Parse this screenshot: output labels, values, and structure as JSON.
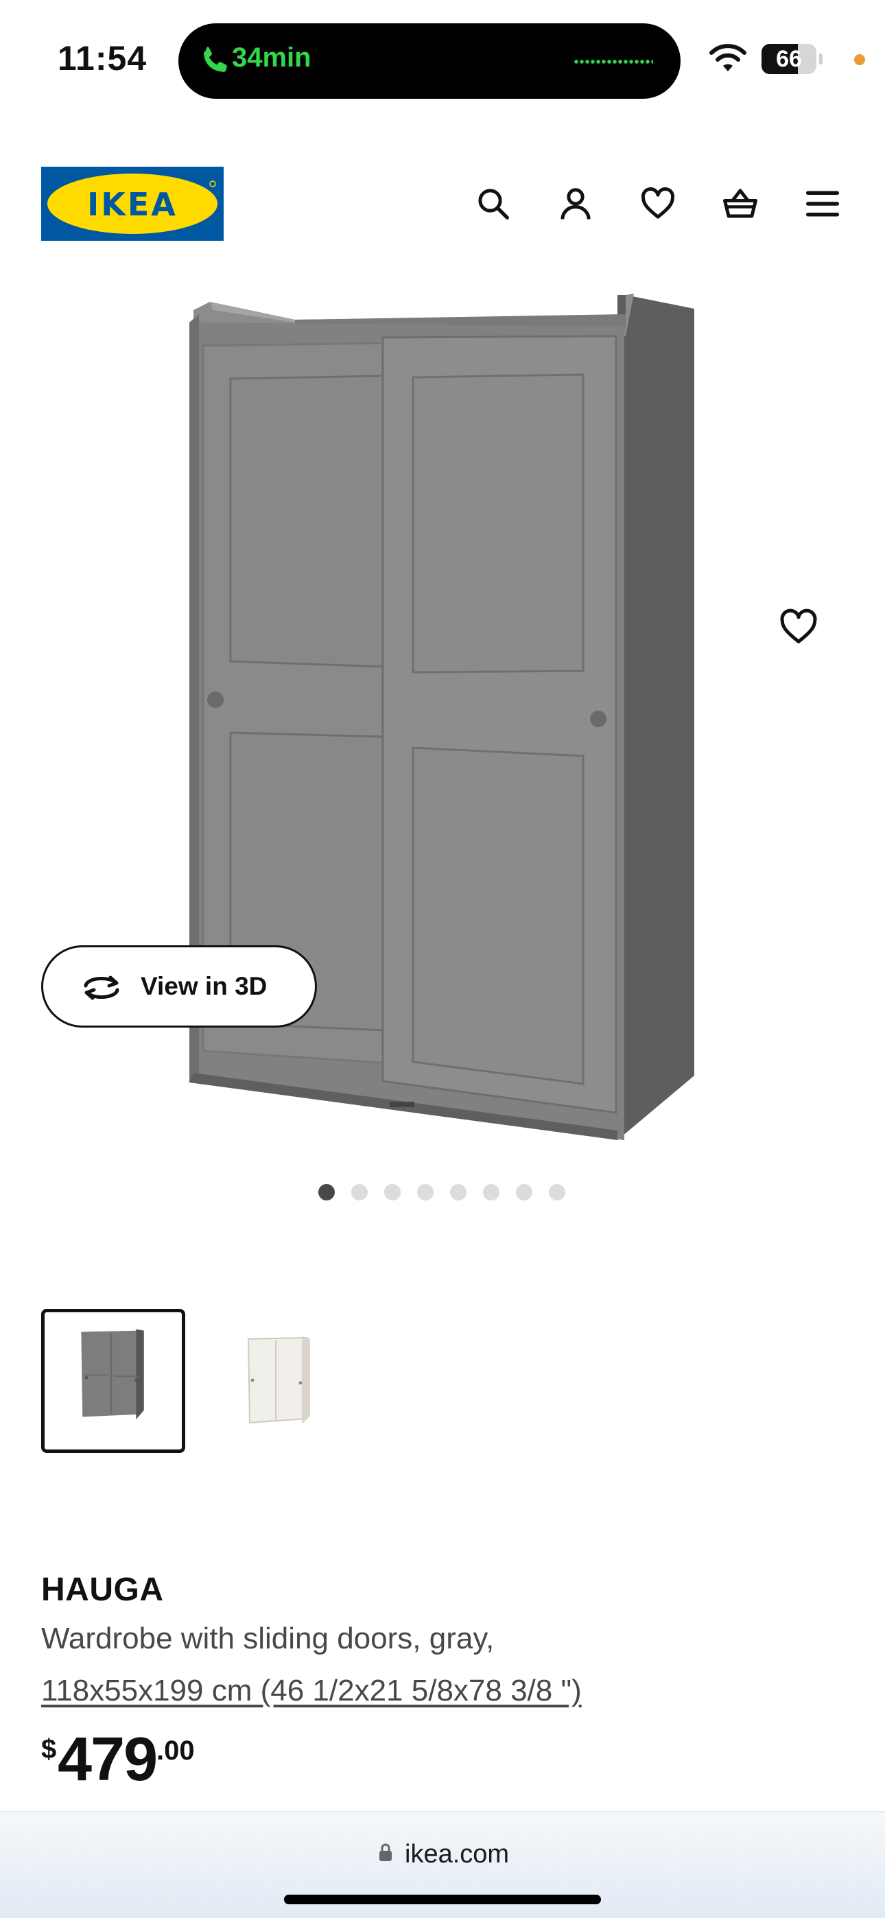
{
  "status_bar": {
    "time": "11:54",
    "call_timer": "34min",
    "battery_level": "66",
    "battery_fraction": 0.66,
    "icons": [
      "phone-icon",
      "wifi-icon",
      "battery-icon"
    ]
  },
  "header": {
    "logo_text": "IKEA",
    "logo_colors": {
      "blue": "#0058a3",
      "yellow": "#ffdb00"
    },
    "icons": [
      "search-icon",
      "account-icon",
      "heart-icon",
      "cart-icon",
      "menu-icon"
    ]
  },
  "gallery": {
    "view_3d_label": "View in 3D",
    "slide_count": 8,
    "active_slide": 1
  },
  "variants": [
    {
      "name": "gray",
      "selected": true
    },
    {
      "name": "white",
      "selected": false
    }
  ],
  "product": {
    "name": "HAUGA",
    "description": "Wardrobe with sliding doors, gray,",
    "dimensions": "118x55x199 cm (46 1/2x21 5/8x78 3/8 \")",
    "price_currency": "$",
    "price_integer": "479",
    "price_decimal": ".00"
  },
  "browser": {
    "url": "ikea.com"
  },
  "colors": {
    "accent_green": "#32d74b",
    "text_dark": "#111111",
    "text_gray": "#484848",
    "wardrobe_gray": "#8a8a8a"
  }
}
